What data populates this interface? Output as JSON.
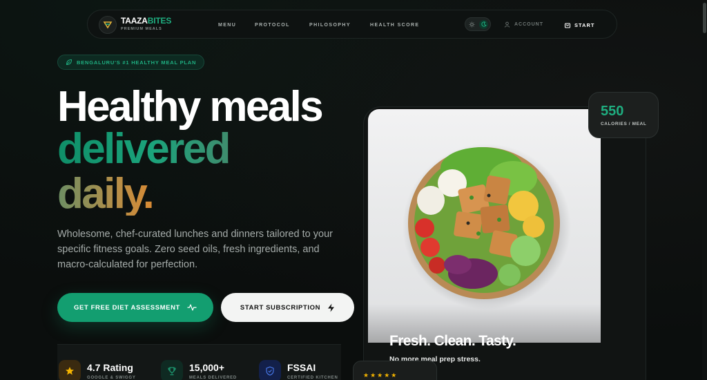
{
  "brand": {
    "name_part1": "TAAZA",
    "name_part2": "BITES",
    "tagline": "PREMIUM MEALS"
  },
  "nav": {
    "links": [
      "MENU",
      "PROTOCOL",
      "PHILOSOPHY",
      "HEALTH SCORE"
    ],
    "account_label": "ACCOUNT",
    "start_label": "START",
    "theme": "dark"
  },
  "hero": {
    "badge": "BENGALURU'S #1 HEALTHY MEAL PLAN",
    "headline_line1": "Healthy meals",
    "headline_line2": "delivered",
    "headline_line3": "daily.",
    "lede": "Wholesome, chef-curated lunches and dinners tailored to your specific fitness goals. Zero seed oils, fresh ingredients, and macro-calculated for perfection.",
    "primary_cta": "GET FREE DIET ASSESSMENT",
    "secondary_cta": "START SUBSCRIPTION"
  },
  "stats": [
    {
      "value": "4.7 Rating",
      "label": "GOOGLE & SWIGGY",
      "icon": "star-icon"
    },
    {
      "value": "15,000+",
      "label": "MEALS DELIVERED",
      "icon": "trophy-icon"
    },
    {
      "value": "FSSAI",
      "label": "CERTIFIED KITCHEN",
      "icon": "shield-icon"
    }
  ],
  "showcase": {
    "title": "Fresh. Clean. Tasty.",
    "subtitle": "No more meal prep stress.",
    "calories_value": "550",
    "calories_label": "CALORIES / MEAL",
    "review_stars": "★★★★★"
  },
  "colors": {
    "accent": "#139e70",
    "accent_text": "#1fae80",
    "background": "#0b0e0d",
    "star": "#f5b400"
  }
}
